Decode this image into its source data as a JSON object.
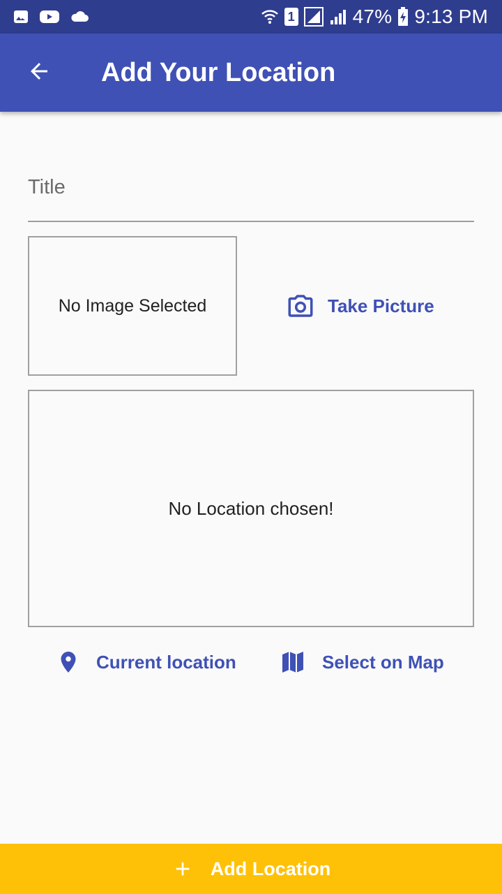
{
  "status_bar": {
    "battery": "47%",
    "time": "9:13 PM",
    "sim_slot": "1",
    "notification_icons": [
      "gallery-icon",
      "youtube-icon",
      "cloud-icon"
    ],
    "system_icons": [
      "wifi-icon",
      "sim-icon",
      "signal-icon",
      "signal-icon",
      "battery-charging-icon"
    ]
  },
  "app_bar": {
    "title": "Add Your Location",
    "back_icon": "arrow-back-icon"
  },
  "form": {
    "title_placeholder": "Title",
    "title_value": "",
    "image_preview_text": "No Image Selected",
    "take_picture_label": "Take Picture",
    "take_picture_icon": "camera-icon",
    "location_preview_text": "No Location chosen!",
    "current_location_label": "Current location",
    "current_location_icon": "location-pin-icon",
    "select_on_map_label": "Select on Map",
    "select_on_map_icon": "map-icon"
  },
  "footer": {
    "add_location_label": "Add Location",
    "add_icon": "plus-icon"
  },
  "colors": {
    "status_bar": "#2f3d8f",
    "primary": "#3f51b5",
    "accent": "#ffc107",
    "background": "#fafafa"
  }
}
